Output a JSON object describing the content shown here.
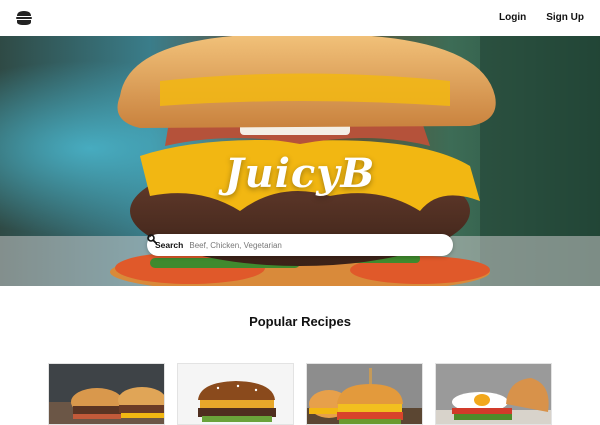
{
  "header": {
    "logo_icon": "burger-icon",
    "login_label": "Login",
    "signup_label": "Sign Up"
  },
  "hero": {
    "brand": "JuicyB",
    "search": {
      "label": "Search",
      "placeholder": "Beef, Chicken, Vegetarian",
      "icon": "search-icon"
    }
  },
  "popular": {
    "title": "Popular Recipes",
    "cards": [
      {
        "image": "burger-photo-1"
      },
      {
        "image": "burger-photo-2"
      },
      {
        "image": "burger-photo-3"
      },
      {
        "image": "burger-photo-4"
      }
    ]
  },
  "colors": {
    "bun": "#e3a24f",
    "cheese": "#f2b712",
    "patty": "#5a3423",
    "text_dark": "#111111",
    "background": "#ffffff"
  }
}
